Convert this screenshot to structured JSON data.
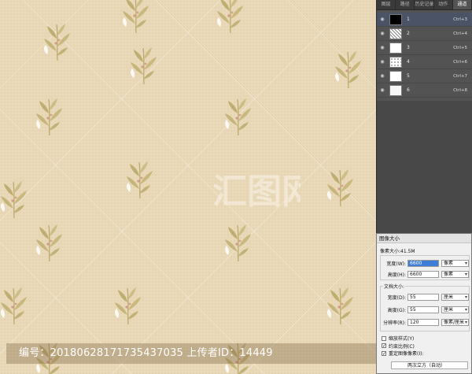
{
  "caption": {
    "text": "编号：20180628171735437035 上传者ID：14449"
  },
  "panel": {
    "tabs": [
      {
        "label": "图层",
        "active": false
      },
      {
        "label": "路径",
        "active": false
      },
      {
        "label": "历史记录",
        "active": false
      },
      {
        "label": "动作",
        "active": false
      },
      {
        "label": "通道",
        "active": true
      }
    ],
    "channels": [
      {
        "name": "1",
        "shortcut": "Ctrl+3",
        "thumb": "black",
        "selected": true
      },
      {
        "name": "2",
        "shortcut": "Ctrl+4",
        "thumb": "noise",
        "selected": false
      },
      {
        "name": "3",
        "shortcut": "Ctrl+5",
        "thumb": "white",
        "selected": false
      },
      {
        "name": "4",
        "shortcut": "Ctrl+6",
        "thumb": "dots",
        "selected": false
      },
      {
        "name": "5",
        "shortcut": "Ctrl+7",
        "thumb": "white",
        "selected": false
      },
      {
        "name": "6",
        "shortcut": "Ctrl+8",
        "thumb": "light",
        "selected": false
      }
    ]
  },
  "dialog": {
    "title": "图像大小",
    "pixel_size": "像素大小:41.5M",
    "pixel_group": "像素大小",
    "width_label": "宽度(W):",
    "width_value": "6600",
    "width_unit": "像素",
    "height_label": "高度(H):",
    "height_value": "6600",
    "height_unit": "像素",
    "doc_group": "文档大小:",
    "doc_width_label": "宽度(D):",
    "doc_width_value": "55",
    "doc_width_unit": "厘米",
    "doc_height_label": "高度(G):",
    "doc_height_value": "55",
    "doc_height_unit": "厘米",
    "resolution_label": "分辨率(R):",
    "resolution_value": "120",
    "resolution_unit": "像素/厘米",
    "scale_styles": "缩放样式(Y)",
    "constrain": "约束比例(C)",
    "resample": "重定图像像素(I):",
    "resample_method": "两次立方（自动）"
  }
}
